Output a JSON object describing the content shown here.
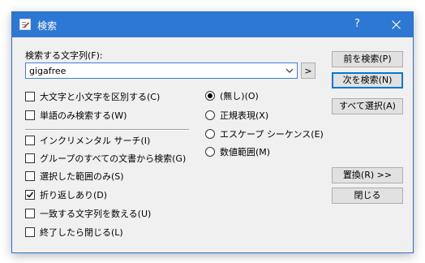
{
  "window": {
    "title": "検索",
    "help": "?"
  },
  "search": {
    "label": "検索する文字列(F):",
    "value": "gigafree",
    "more_button": ">"
  },
  "buttons": {
    "prev": "前を検索(P)",
    "next": "次を検索(N)",
    "select_all": "すべて選択(A)",
    "replace": "置換(R) >>",
    "close": "閉じる"
  },
  "checkboxes": [
    {
      "label": "大文字と小文字を区別する(C)",
      "checked": false
    },
    {
      "label": "単語のみ検索する(W)",
      "checked": false
    },
    {
      "label": "インクリメンタル サーチ(I)",
      "checked": false
    },
    {
      "label": "グループのすべての文書から検索(G)",
      "checked": false
    },
    {
      "label": "選択した範囲のみ(S)",
      "checked": false
    },
    {
      "label": "折り返しあり(D)",
      "checked": true
    },
    {
      "label": "一致する文字列を数える(U)",
      "checked": false
    },
    {
      "label": "終了したら閉じる(L)",
      "checked": false
    }
  ],
  "radios": [
    {
      "label": "(無し)(O)",
      "selected": true
    },
    {
      "label": "正規表現(X)",
      "selected": false
    },
    {
      "label": "エスケープ シーケンス(E)",
      "selected": false
    },
    {
      "label": "数値範囲(M)",
      "selected": false
    }
  ],
  "colors": {
    "titlebar": "#2c78d4",
    "accent": "#0078d7"
  }
}
